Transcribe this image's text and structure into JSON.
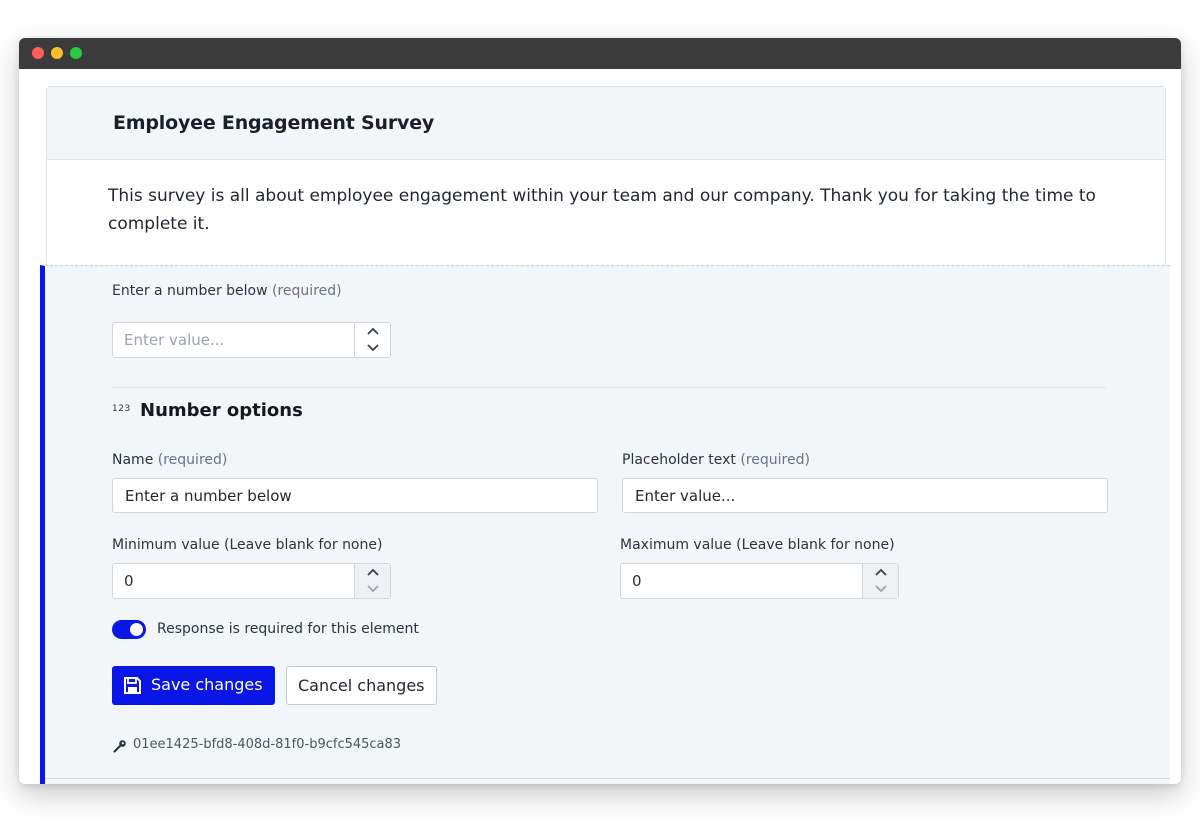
{
  "window": {
    "controls": [
      "close",
      "minimize",
      "maximize"
    ],
    "colors": {
      "close": "#ff5f56",
      "minimize": "#ffbd2e",
      "maximize": "#27c93f",
      "titlebar": "#3b3b3b"
    }
  },
  "survey": {
    "title": "Employee Engagement Survey",
    "description": "This survey is all about employee engagement within your team and our company. Thank you for taking the time to complete it."
  },
  "preview": {
    "question_label": "Enter a number below",
    "required_note": "(required)",
    "input_placeholder": "Enter value...",
    "up_icon": "chevron-up-icon",
    "down_icon": "chevron-down-icon"
  },
  "options": {
    "icon": "123",
    "title": "Number options",
    "name_label": "Name",
    "name_required": "(required)",
    "name_value": "Enter a number below",
    "placeholder_label": "Placeholder text",
    "placeholder_required": "(required)",
    "placeholder_value": "Enter value...",
    "min_label": "Minimum value (Leave blank for none)",
    "min_value": "0",
    "max_label": "Maximum value (Leave blank for none)",
    "max_value": "0",
    "toggle_label": "Response is required for this element",
    "toggle_on": true,
    "save_label": "Save changes",
    "save_icon": "floppy-disk-icon",
    "cancel_label": "Cancel changes",
    "element_id": "01ee1425-bfd8-408d-81f0-b9cfc545ca83",
    "id_icon": "key-icon"
  },
  "colors": {
    "accent": "#0a16e6",
    "panel": "#f3f6f9",
    "border": "#dfe3e8"
  }
}
